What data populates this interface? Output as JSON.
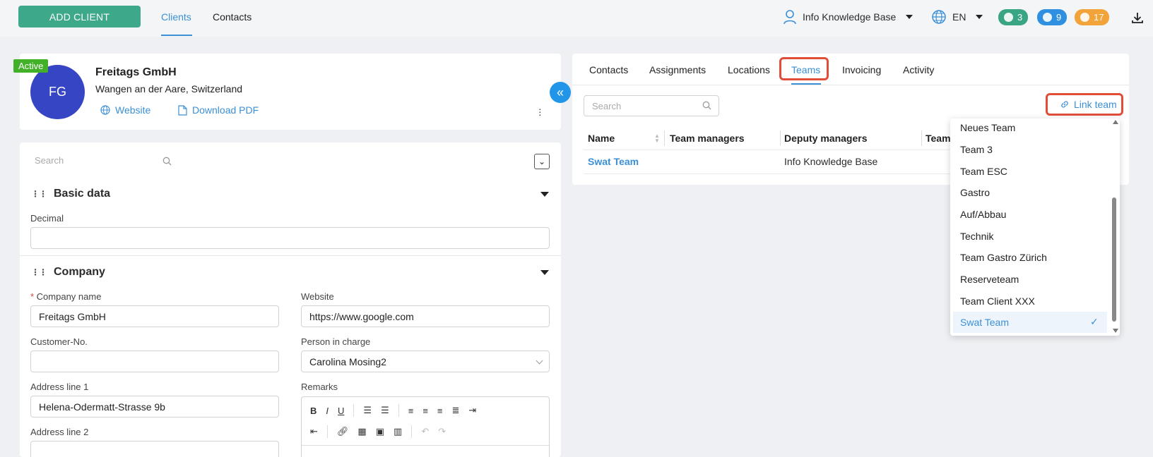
{
  "topbar": {
    "add_client": "ADD CLIENT",
    "nav": [
      "Clients",
      "Contacts"
    ],
    "user": "Info Knowledge Base",
    "lang": "EN",
    "badges": [
      {
        "count": "3",
        "color": "#3aa584",
        "icon": "chat-icon"
      },
      {
        "count": "9",
        "color": "#2f8fe0",
        "icon": "bell-icon"
      },
      {
        "count": "17",
        "color": "#f2a33a",
        "icon": "clock-icon"
      }
    ]
  },
  "profile": {
    "status": "Active",
    "initials": "FG",
    "name": "Freitags GmbH",
    "address": "Wangen an der Aare, Switzerland",
    "website_link": "Website",
    "pdf_link": "Download PDF"
  },
  "form": {
    "search_placeholder": "Search",
    "section_basic": "Basic data",
    "decimal_label": "Decimal",
    "section_company": "Company",
    "company_name_label": "Company name",
    "company_name_value": "Freitags GmbH",
    "website_label": "Website",
    "website_value": "https://www.google.com",
    "customer_no_label": "Customer-No.",
    "person_label": "Person in charge",
    "person_value": "Carolina Mosing2",
    "address1_label": "Address line 1",
    "address1_value": "Helena-Odermatt-Strasse 9b",
    "remarks_label": "Remarks",
    "address2_label": "Address line 2"
  },
  "right": {
    "tabs": [
      "Contacts",
      "Assignments",
      "Locations",
      "Teams",
      "Invoicing",
      "Activity"
    ],
    "active_tab": "Teams",
    "search_placeholder": "Search",
    "link_team": "Link team",
    "columns": [
      "Name",
      "Team managers",
      "Deputy managers",
      "Team"
    ],
    "rows": [
      {
        "name": "Swat Team",
        "team_managers": "",
        "deputy_managers": "Info Knowledge Base"
      }
    ]
  },
  "dropdown": {
    "items": [
      "Neues Team",
      "Team 3",
      "Team ESC",
      "Gastro",
      "Auf/Abbau",
      "Technik",
      "Team Gastro Zürich",
      "Reserveteam",
      "Team Client XXX",
      "Swat Team"
    ],
    "selected": "Swat Team"
  },
  "colors": {
    "accent": "#3b8fd6",
    "primary_green": "#3ea98a",
    "highlight": "#e04e3a"
  }
}
